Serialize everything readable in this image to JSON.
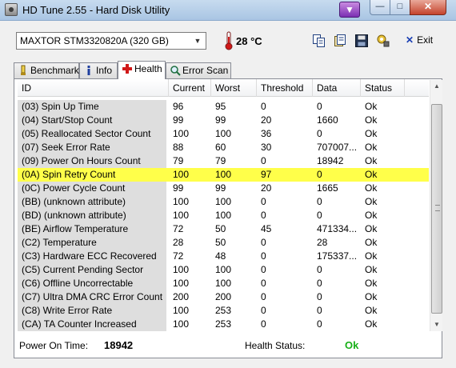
{
  "window": {
    "title": "HD Tune 2.55 - Hard Disk Utility"
  },
  "toolbar": {
    "drive": "MAXTOR STM3320820A (320 GB)",
    "temperature": "28 °C",
    "exit_label": "Exit"
  },
  "tabs": [
    {
      "label": "Benchmark",
      "icon": "benchmark-icon"
    },
    {
      "label": "Info",
      "icon": "info-icon"
    },
    {
      "label": "Health",
      "icon": "health-cross-icon",
      "active": true
    },
    {
      "label": "Error Scan",
      "icon": "magnifier-icon"
    }
  ],
  "table": {
    "columns": [
      "ID",
      "Current",
      "Worst",
      "Threshold",
      "Data",
      "Status"
    ],
    "highlight_color": "#ffff4a",
    "highlighted_row": 5,
    "rows": [
      [
        "(03) Spin Up Time",
        "96",
        "95",
        "0",
        "0",
        "Ok"
      ],
      [
        "(04) Start/Stop Count",
        "99",
        "99",
        "20",
        "1660",
        "Ok"
      ],
      [
        "(05) Reallocated Sector Count",
        "100",
        "100",
        "36",
        "0",
        "Ok"
      ],
      [
        "(07) Seek Error Rate",
        "88",
        "60",
        "30",
        "707007...",
        "Ok"
      ],
      [
        "(09) Power On Hours Count",
        "79",
        "79",
        "0",
        "18942",
        "Ok"
      ],
      [
        "(0A) Spin Retry Count",
        "100",
        "100",
        "97",
        "0",
        "Ok"
      ],
      [
        "(0C) Power Cycle Count",
        "99",
        "99",
        "20",
        "1665",
        "Ok"
      ],
      [
        "(BB) (unknown attribute)",
        "100",
        "100",
        "0",
        "0",
        "Ok"
      ],
      [
        "(BD) (unknown attribute)",
        "100",
        "100",
        "0",
        "0",
        "Ok"
      ],
      [
        "(BE) Airflow Temperature",
        "72",
        "50",
        "45",
        "471334...",
        "Ok"
      ],
      [
        "(C2) Temperature",
        "28",
        "50",
        "0",
        "28",
        "Ok"
      ],
      [
        "(C3) Hardware ECC Recovered",
        "72",
        "48",
        "0",
        "175337...",
        "Ok"
      ],
      [
        "(C5) Current Pending Sector",
        "100",
        "100",
        "0",
        "0",
        "Ok"
      ],
      [
        "(C6) Offline Uncorrectable",
        "100",
        "100",
        "0",
        "0",
        "Ok"
      ],
      [
        "(C7) Ultra DMA CRC Error Count",
        "200",
        "200",
        "0",
        "0",
        "Ok"
      ],
      [
        "(C8) Write Error Rate",
        "100",
        "253",
        "0",
        "0",
        "Ok"
      ],
      [
        "(CA) TA Counter Increased",
        "100",
        "253",
        "0",
        "0",
        "Ok"
      ]
    ]
  },
  "footer": {
    "power_on_label": "Power On Time:",
    "power_on_value": "18942",
    "health_label": "Health Status:",
    "health_value": "Ok",
    "health_color": "#18b018"
  }
}
